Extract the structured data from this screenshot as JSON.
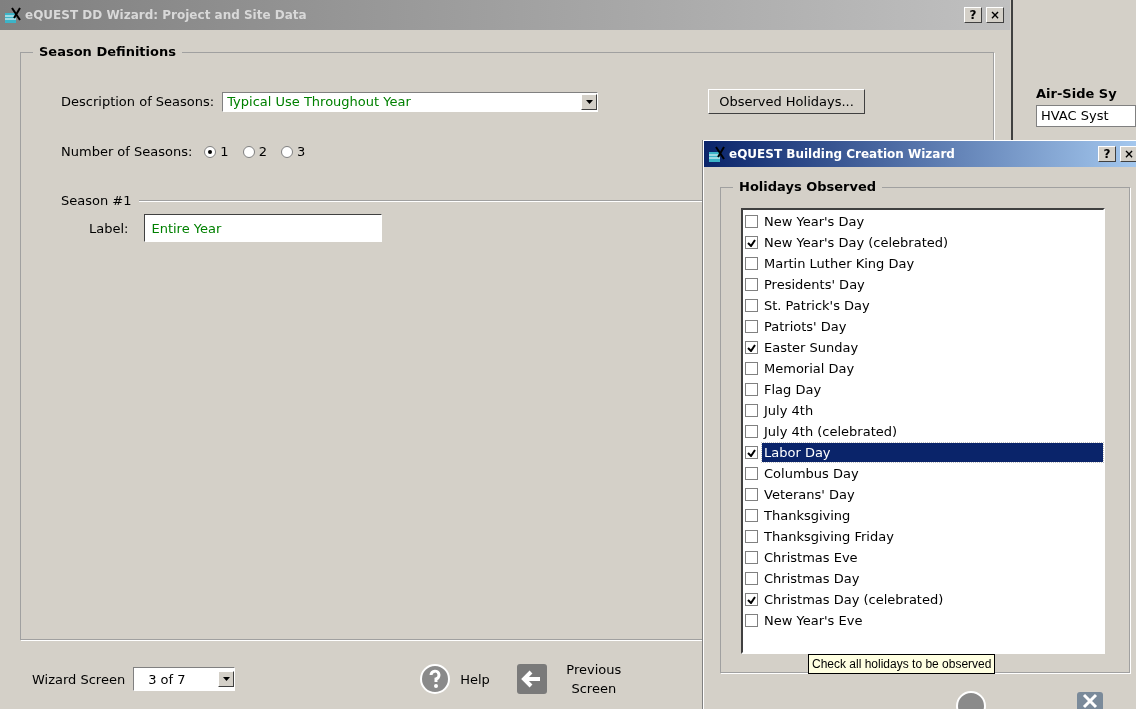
{
  "main_window": {
    "title": "eQUEST DD Wizard: Project and Site Data",
    "title_buttons": [
      "?",
      "×"
    ],
    "season_definitions": {
      "title": "Season Definitions",
      "description_label": "Description of Seasons:",
      "description_value": "Typical Use Throughout Year",
      "observed_holidays_button": "Observed Holidays...",
      "number_label": "Number of Seasons:",
      "season_options": [
        {
          "label": "1",
          "selected": true
        },
        {
          "label": "2",
          "selected": false
        },
        {
          "label": "3",
          "selected": false
        }
      ],
      "season_group": "Season #1",
      "label_caption": "Label:",
      "label_value": "Entire Year"
    },
    "footer": {
      "wizard_screen_label": "Wizard Screen",
      "wizard_screen_value": "3 of 7",
      "help": "Help",
      "previous": "Previous Screen"
    }
  },
  "side_panel": {
    "heading": "Air-Side Sy",
    "field_value": "HVAC Syst"
  },
  "holiday_dialog": {
    "title": "eQUEST Building Creation Wizard",
    "title_buttons": [
      "?",
      "×"
    ],
    "group_title": "Holidays Observed",
    "holidays": [
      {
        "label": "New Year's Day",
        "checked": false,
        "selected": false
      },
      {
        "label": "New Year's Day (celebrated)",
        "checked": true,
        "selected": false
      },
      {
        "label": "Martin Luther King Day",
        "checked": false,
        "selected": false
      },
      {
        "label": "Presidents' Day",
        "checked": false,
        "selected": false
      },
      {
        "label": "St. Patrick's Day",
        "checked": false,
        "selected": false
      },
      {
        "label": "Patriots' Day",
        "checked": false,
        "selected": false
      },
      {
        "label": "Easter Sunday",
        "checked": true,
        "selected": false
      },
      {
        "label": "Memorial Day",
        "checked": false,
        "selected": false
      },
      {
        "label": "Flag Day",
        "checked": false,
        "selected": false
      },
      {
        "label": "July 4th",
        "checked": false,
        "selected": false
      },
      {
        "label": "July 4th (celebrated)",
        "checked": false,
        "selected": false
      },
      {
        "label": "Labor Day",
        "checked": true,
        "selected": true
      },
      {
        "label": "Columbus Day",
        "checked": false,
        "selected": false
      },
      {
        "label": "Veterans' Day",
        "checked": false,
        "selected": false
      },
      {
        "label": "Thanksgiving",
        "checked": false,
        "selected": false
      },
      {
        "label": "Thanksgiving Friday",
        "checked": false,
        "selected": false
      },
      {
        "label": "Christmas Eve",
        "checked": false,
        "selected": false
      },
      {
        "label": "Christmas Day",
        "checked": false,
        "selected": false
      },
      {
        "label": "Christmas Day (celebrated)",
        "checked": true,
        "selected": false
      },
      {
        "label": "New Year's Eve",
        "checked": false,
        "selected": false
      }
    ],
    "tooltip": "Check all holidays to be observed"
  }
}
